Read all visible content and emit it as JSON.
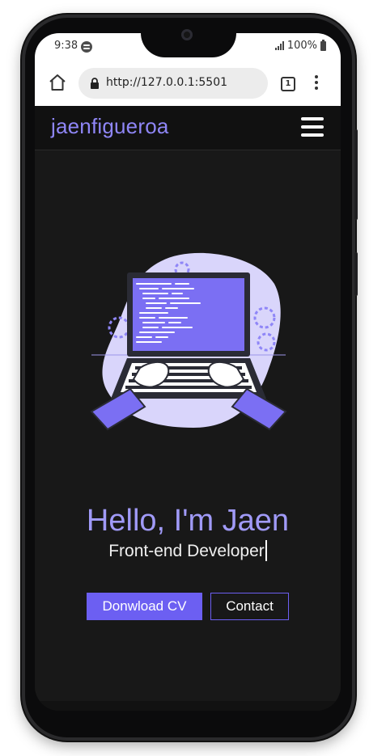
{
  "status_bar": {
    "time": "9:38",
    "battery": "100%",
    "icons": [
      "spotify-icon",
      "signal-icon",
      "battery-icon"
    ]
  },
  "browser": {
    "url": "http://127.0.0.1:5501",
    "tab_count": "1",
    "icons": [
      "home-icon",
      "lock-icon",
      "tabs-icon",
      "more-vert-icon"
    ]
  },
  "site": {
    "brand": "jaenfigueroa",
    "menu_icon": "hamburger-icon"
  },
  "hero": {
    "title": "Hello, I'm Jaen",
    "subtitle": "Front-end Developer",
    "illustration": "developer-laptop-illustration"
  },
  "actions": {
    "download_cv": "Donwload CV",
    "contact": "Contact"
  },
  "colors": {
    "accent": "#6c5ff2",
    "brand_text": "#8f86f7",
    "title_text": "#a09af8",
    "page_bg": "#181818",
    "nav_bg": "#111111"
  }
}
